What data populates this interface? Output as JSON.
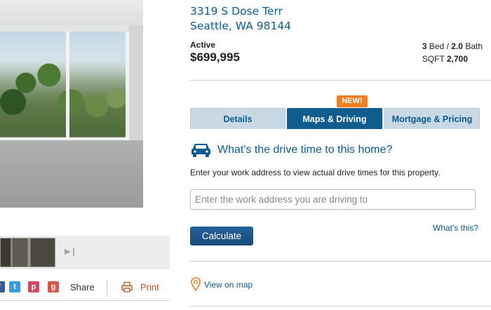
{
  "listing": {
    "address_line1": "3319 S Dose Terr",
    "address_line2": "Seattle, WA 98144",
    "status": "Active",
    "price": "$699,995",
    "beds": "3",
    "beds_label": "Bed /",
    "baths": "2.0",
    "baths_label": "Bath",
    "sqft_label": "SQFT",
    "sqft": "2,700"
  },
  "share": {
    "label": "Share",
    "print_label": "Print",
    "icons": [
      "facebook-icon",
      "twitter-icon",
      "pinterest-icon",
      "google-plus-icon"
    ]
  },
  "tabs": {
    "new_badge": "NEW!",
    "items": [
      {
        "label": "Details"
      },
      {
        "label": "Maps & Driving"
      },
      {
        "label": "Mortgage & Pricing"
      }
    ],
    "active_index": 1
  },
  "drive": {
    "question": "What's the drive time to this home?",
    "description": "Enter your work address to view actual drive times for this property.",
    "input_placeholder": "Enter the work address you are driving to",
    "input_value": "",
    "calculate_label": "Calculate",
    "whats_this": "What's this?",
    "view_on_map": "View on map"
  },
  "colors": {
    "link_blue": "#0c5b93",
    "active_tab": "#0f5c8f",
    "inactive_tab": "#c8d8e4",
    "badge_orange": "#f07f21",
    "print_orange": "#c0531e",
    "button_blue": "#1a4c7c"
  }
}
